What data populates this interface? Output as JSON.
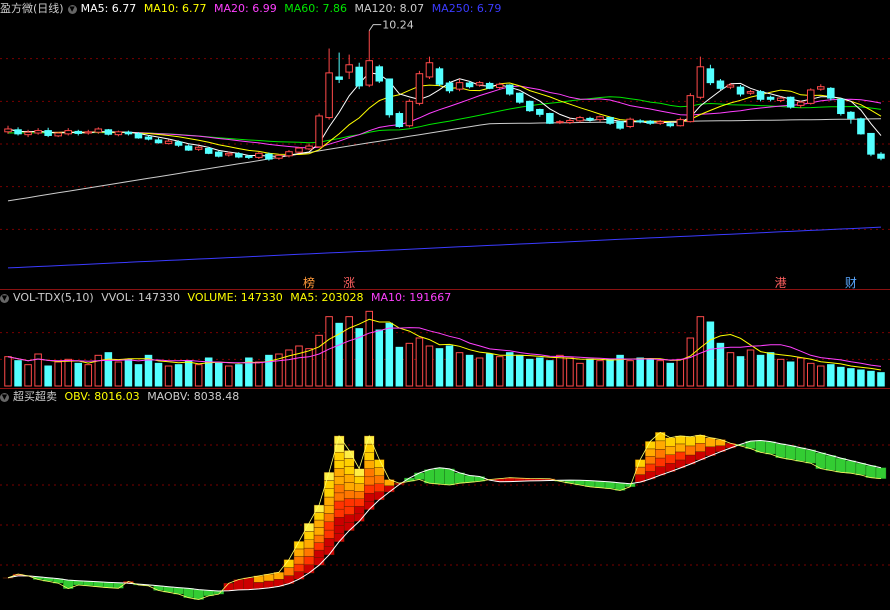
{
  "main_header": {
    "title": "盈方微(日线)",
    "ma5": "MA5: 6.77",
    "ma10": "MA10: 6.77",
    "ma20": "MA20: 6.99",
    "ma60": "MA60: 7.86",
    "ma120": "MA120: 8.07",
    "ma250": "MA250: 6.79"
  },
  "high_label": "10.24",
  "badges": [
    "榜",
    "涨",
    "港",
    "财"
  ],
  "vol_header": {
    "name": "VOL-TDX(5,10)",
    "vvol": "VVOL: 147330",
    "volume": "VOLUME: 147330",
    "ma5": "MA5: 203028",
    "ma10": "MA10: 191667"
  },
  "obv_header": {
    "name": "超买超卖",
    "obv": "OBV: 8016.03",
    "maobv": "MAOBV: 8038.48"
  },
  "colors": {
    "up": "#ff4a4a",
    "down": "#54ffff",
    "ma5": "#ffffff",
    "ma10": "#ffff00",
    "ma20": "#ff40ff",
    "ma60": "#00e600",
    "ma120": "#cccccc",
    "ma250": "#3b3bff",
    "grid": "#7a0000"
  },
  "chart_data": {
    "type": "candlestick",
    "price": {
      "count": 88,
      "open": [
        7.75,
        7.8,
        7.68,
        7.72,
        7.78,
        7.65,
        7.7,
        7.76,
        7.72,
        7.74,
        7.8,
        7.68,
        7.74,
        7.7,
        7.62,
        7.55,
        7.46,
        7.5,
        7.4,
        7.32,
        7.34,
        7.25,
        7.18,
        7.21,
        7.15,
        7.12,
        7.2,
        7.1,
        7.16,
        7.25,
        7.33,
        7.38,
        8.1,
        9.1,
        9.22,
        9.34,
        8.9,
        9.35,
        9.05,
        8.2,
        7.9,
        8.45,
        9.1,
        9.3,
        8.95,
        8.8,
        8.95,
        8.9,
        8.94,
        8.84,
        8.9,
        8.7,
        8.5,
        8.3,
        8.2,
        8.0,
        7.98,
        8.02,
        8.08,
        8.05,
        8.1,
        8.0,
        7.88,
        8.02,
        8.01,
        7.96,
        7.95,
        7.9,
        8.0,
        8.6,
        9.3,
        9.0,
        8.85,
        8.85,
        8.7,
        8.74,
        8.6,
        8.52,
        8.6,
        8.4,
        8.45,
        8.8,
        8.82,
        8.55,
        8.23,
        8.07,
        7.71,
        7.2
      ],
      "close": [
        7.82,
        7.7,
        7.74,
        7.78,
        7.66,
        7.72,
        7.78,
        7.71,
        7.75,
        7.82,
        7.69,
        7.75,
        7.7,
        7.6,
        7.57,
        7.48,
        7.52,
        7.42,
        7.3,
        7.37,
        7.22,
        7.15,
        7.22,
        7.13,
        7.12,
        7.22,
        7.08,
        7.17,
        7.26,
        7.35,
        7.4,
        8.14,
        9.2,
        9.04,
        9.4,
        8.88,
        9.5,
        9.0,
        8.17,
        7.88,
        8.5,
        9.18,
        9.45,
        8.92,
        8.76,
        8.96,
        8.86,
        8.96,
        8.82,
        8.92,
        8.68,
        8.48,
        8.27,
        8.18,
        7.96,
        8.0,
        8.03,
        8.1,
        8.04,
        8.12,
        7.96,
        7.84,
        8.06,
        8.01,
        7.96,
        8.0,
        7.9,
        8.05,
        8.64,
        9.35,
        8.96,
        8.82,
        8.9,
        8.68,
        8.74,
        8.55,
        8.55,
        8.58,
        8.36,
        8.48,
        8.78,
        8.86,
        8.58,
        8.2,
        8.08,
        7.7,
        7.2,
        7.1
      ],
      "high": [
        7.9,
        7.86,
        7.8,
        7.84,
        7.85,
        7.74,
        7.84,
        7.8,
        7.8,
        7.86,
        7.82,
        7.78,
        7.78,
        7.74,
        7.66,
        7.6,
        7.56,
        7.54,
        7.44,
        7.4,
        7.38,
        7.28,
        7.26,
        7.25,
        7.18,
        7.26,
        7.24,
        7.2,
        7.3,
        7.38,
        7.46,
        8.2,
        9.8,
        9.7,
        9.65,
        9.45,
        10.24,
        9.4,
        9.05,
        8.25,
        8.55,
        9.25,
        9.6,
        9.35,
        9.0,
        9.05,
        9.0,
        9.0,
        8.98,
        8.96,
        8.92,
        8.72,
        8.52,
        8.32,
        8.22,
        8.04,
        8.08,
        8.14,
        8.12,
        8.15,
        8.12,
        8.02,
        8.1,
        8.06,
        8.04,
        8.04,
        7.98,
        8.1,
        8.7,
        9.6,
        9.4,
        9.05,
        8.95,
        8.9,
        8.78,
        8.78,
        8.64,
        8.62,
        8.62,
        8.52,
        8.82,
        8.92,
        8.85,
        8.58,
        8.26,
        8.1,
        7.72,
        7.25
      ],
      "low": [
        7.7,
        7.66,
        7.62,
        7.68,
        7.62,
        7.62,
        7.66,
        7.66,
        7.68,
        7.7,
        7.66,
        7.64,
        7.66,
        7.58,
        7.54,
        7.46,
        7.44,
        7.38,
        7.28,
        7.28,
        7.2,
        7.12,
        7.14,
        7.1,
        7.08,
        7.08,
        7.04,
        7.06,
        7.12,
        7.22,
        7.3,
        7.36,
        8.05,
        8.95,
        9.05,
        8.8,
        8.85,
        8.95,
        8.1,
        7.85,
        7.86,
        8.4,
        9.05,
        8.88,
        8.7,
        8.75,
        8.82,
        8.86,
        8.8,
        8.8,
        8.64,
        8.44,
        8.24,
        8.12,
        7.94,
        7.94,
        7.94,
        7.98,
        8.0,
        8.0,
        7.92,
        7.8,
        7.84,
        7.96,
        7.92,
        7.92,
        7.86,
        7.88,
        7.98,
        8.55,
        8.9,
        8.78,
        8.8,
        8.62,
        8.66,
        8.5,
        8.5,
        8.48,
        8.32,
        8.34,
        8.42,
        8.76,
        8.52,
        8.15,
        7.95,
        7.68,
        7.15,
        7.05
      ],
      "ylim": [
        4.3,
        10.6
      ]
    },
    "volume": {
      "values": [
        220,
        190,
        160,
        240,
        150,
        180,
        200,
        170,
        160,
        230,
        250,
        180,
        200,
        160,
        230,
        170,
        150,
        160,
        190,
        160,
        210,
        170,
        150,
        160,
        210,
        180,
        230,
        240,
        270,
        300,
        280,
        380,
        520,
        470,
        520,
        430,
        560,
        420,
        470,
        290,
        320,
        360,
        300,
        280,
        300,
        250,
        230,
        210,
        240,
        220,
        250,
        230,
        200,
        210,
        190,
        230,
        210,
        170,
        200,
        190,
        200,
        230,
        190,
        210,
        200,
        190,
        170,
        200,
        360,
        520,
        480,
        320,
        250,
        220,
        270,
        230,
        250,
        200,
        180,
        210,
        170,
        150,
        160,
        140,
        130,
        120,
        110,
        100
      ],
      "ylim": [
        0,
        600
      ]
    },
    "obv": {
      "values": [
        7400,
        7420,
        7410,
        7390,
        7380,
        7370,
        7340,
        7360,
        7355,
        7350,
        7345,
        7342,
        7380,
        7360,
        7355,
        7330,
        7320,
        7310,
        7290,
        7280,
        7300,
        7310,
        7370,
        7390,
        7400,
        7410,
        7420,
        7430,
        7500,
        7600,
        7700,
        7800,
        7980,
        8180,
        8100,
        8000,
        8180,
        8050,
        7940,
        7920,
        7930,
        7940,
        7920,
        7915,
        7910,
        7920,
        7925,
        7930,
        7940,
        7945,
        7950,
        7948,
        7946,
        7945,
        7944,
        7930,
        7920,
        7910,
        7900,
        7895,
        7890,
        7880,
        7900,
        8050,
        8150,
        8200,
        8170,
        8180,
        8175,
        8185,
        8170,
        8160,
        8140,
        8125,
        8110,
        8090,
        8080,
        8060,
        8050,
        8040,
        8030,
        8000,
        7990,
        7980,
        7975,
        7965,
        7950,
        7945
      ],
      "ylim": [
        7250,
        8350
      ]
    },
    "ma_current": {
      "ma5": 6.77,
      "ma10": 6.77,
      "ma20": 6.99,
      "ma60": 7.86,
      "ma120": 8.07,
      "ma250": 6.79
    }
  }
}
